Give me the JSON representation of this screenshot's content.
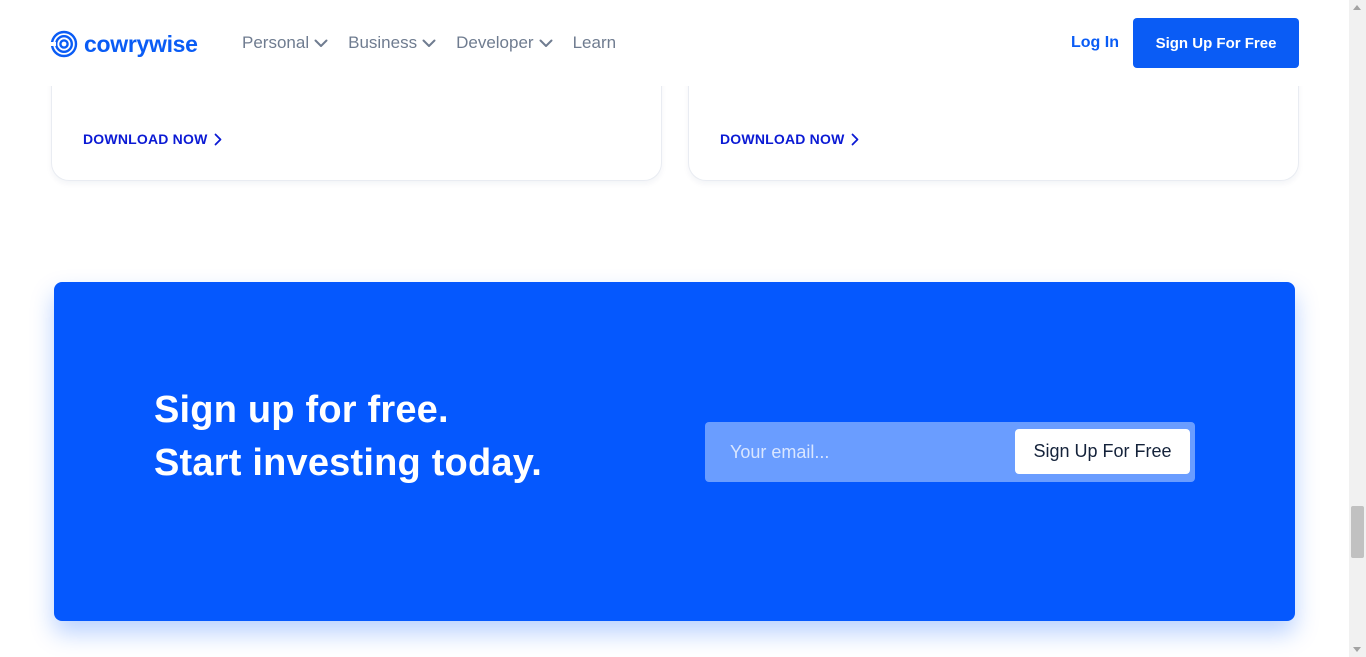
{
  "nav": {
    "logo_text": "cowrywise",
    "menu": [
      {
        "label": "Personal",
        "has_dropdown": true
      },
      {
        "label": "Business",
        "has_dropdown": true
      },
      {
        "label": "Developer",
        "has_dropdown": true
      },
      {
        "label": "Learn",
        "has_dropdown": false
      }
    ],
    "login_label": "Log In",
    "signup_label": "Sign Up For Free"
  },
  "cards": [
    {
      "cta_label": "DOWNLOAD NOW"
    },
    {
      "cta_label": "DOWNLOAD NOW"
    }
  ],
  "cta_banner": {
    "headline_line1": "Sign up for free.",
    "headline_line2": "Start investing today.",
    "email_placeholder": "Your email...",
    "button_label": "Sign Up For Free"
  },
  "icons": {
    "logo": "cowrywise-swirl-icon",
    "dropdown": "chevron-down-icon",
    "arrow": "chevron-right-icon"
  },
  "colors": {
    "brand_blue": "#0a5cf5",
    "banner_blue": "#0558fe",
    "download_link": "#0b1ad4",
    "menu_text": "#6f7c90"
  }
}
